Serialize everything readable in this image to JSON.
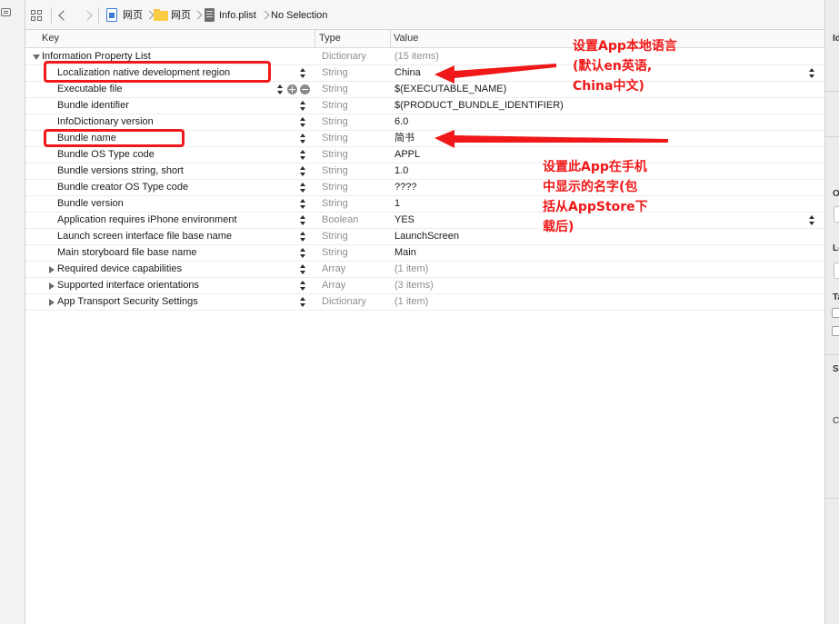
{
  "breadcrumbs": {
    "project": "网页",
    "group": "网页",
    "file": "Info.plist",
    "selection": "No Selection"
  },
  "columns": {
    "key": "Key",
    "type": "Type",
    "value": "Value"
  },
  "root": {
    "key": "Information Property List",
    "type": "Dictionary",
    "value": "(15 items)"
  },
  "rows": [
    {
      "key": "Localization native development region",
      "type": "String",
      "value": "China",
      "disclosure": "none"
    },
    {
      "key": "Executable file",
      "type": "String",
      "value": "$(EXECUTABLE_NAME)",
      "disclosure": "none"
    },
    {
      "key": "Bundle identifier",
      "type": "String",
      "value": "$(PRODUCT_BUNDLE_IDENTIFIER)",
      "disclosure": "none"
    },
    {
      "key": "InfoDictionary version",
      "type": "String",
      "value": "6.0",
      "disclosure": "none"
    },
    {
      "key": "Bundle name",
      "type": "String",
      "value": "简书",
      "disclosure": "none"
    },
    {
      "key": "Bundle OS Type code",
      "type": "String",
      "value": "APPL",
      "disclosure": "none"
    },
    {
      "key": "Bundle versions string, short",
      "type": "String",
      "value": "1.0",
      "disclosure": "none"
    },
    {
      "key": "Bundle creator OS Type code",
      "type": "String",
      "value": "????",
      "disclosure": "none"
    },
    {
      "key": "Bundle version",
      "type": "String",
      "value": "1",
      "disclosure": "none"
    },
    {
      "key": "Application requires iPhone environment",
      "type": "Boolean",
      "value": "YES",
      "disclosure": "none"
    },
    {
      "key": "Launch screen interface file base name",
      "type": "String",
      "value": "LaunchScreen",
      "disclosure": "none"
    },
    {
      "key": "Main storyboard file base name",
      "type": "String",
      "value": "Main",
      "disclosure": "none"
    },
    {
      "key": "Required device capabilities",
      "type": "Array",
      "value": "(1 item)",
      "disclosure": "closed"
    },
    {
      "key": "Supported interface orientations",
      "type": "Array",
      "value": "(3 items)",
      "disclosure": "closed"
    },
    {
      "key": "App Transport Security Settings",
      "type": "Dictionary",
      "value": "(1 item)",
      "disclosure": "closed"
    }
  ],
  "inspector": {
    "label_id": "Id",
    "label_o": "O",
    "label_lo": "Lo",
    "label_ta": "Ta",
    "label_so": "So",
    "text_c": "C"
  },
  "annotations": {
    "localization": [
      "设置App本地语言",
      "(默认en英语,",
      "China中文)"
    ],
    "bundle_name": [
      "设置此App在手机",
      "中显示的名字(包",
      "括从AppStore下",
      "载后)"
    ]
  },
  "colors": {
    "annotation_red": "#f01818",
    "folder_yellow": "#f9cc44",
    "project_blue": "#3a7bd5"
  }
}
